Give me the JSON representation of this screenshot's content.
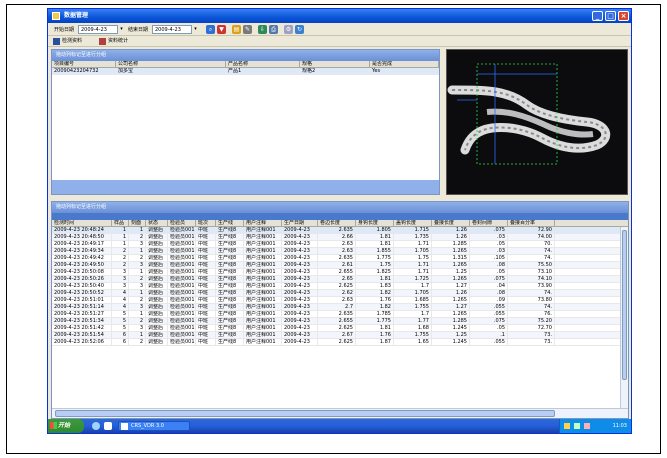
{
  "window": {
    "title": "数据管理"
  },
  "toolbar": {
    "start_label": "开始日期",
    "start_date": "2009-4-23",
    "end_label": "结束日期",
    "end_date": "2009-4-23"
  },
  "tabs": [
    {
      "label": "检测资料"
    },
    {
      "label": "资料统计"
    }
  ],
  "top_panel": {
    "header": "拖动列标记至进行分组",
    "columns": [
      "项目编号",
      "公司名称",
      "产品名称",
      "规格",
      "是否完成"
    ],
    "rows": [
      [
        "20090423204732",
        "加多宝",
        "产品1",
        "规格2",
        "Yes"
      ]
    ]
  },
  "bottom_panel": {
    "header": "拖动列标记至进行分组",
    "columns": [
      "检测时间",
      "样品",
      "刻面",
      "状态",
      "检验员",
      "班次",
      "生产线",
      "用户注释",
      "生产日期",
      "卷边长度",
      "身钩长度",
      "盖钩长度",
      "叠接长度",
      "卷封间隙",
      "叠接百分率"
    ],
    "rows": [
      [
        "2009-4-23 20:48:24",
        "1",
        "1",
        "调整后",
        "检验员001",
        "中班",
        "生产线8",
        "用户注释001",
        "2009-4-23",
        "2.635",
        "1.805",
        "1.715",
        "1.26",
        ".075",
        "72.90"
      ],
      [
        "2009-4-23 20:48:50",
        "1",
        "2",
        "调整后",
        "检验员001",
        "中班",
        "生产线8",
        "用户注释001",
        "2009-4-23",
        "2.66",
        "1.81",
        "1.735",
        "1.26",
        ".03",
        "74.00"
      ],
      [
        "2009-4-23 20:49:17",
        "1",
        "3",
        "调整后",
        "检验员001",
        "中班",
        "生产线8",
        "用户注释001",
        "2009-4-23",
        "2.63",
        "1.81",
        "1.71",
        "1.285",
        ".05",
        "70."
      ],
      [
        "2009-4-23 20:49:34",
        "2",
        "1",
        "调整后",
        "检验员001",
        "中班",
        "生产线8",
        "用户注释001",
        "2009-4-23",
        "2.63",
        "1.855",
        "1.705",
        "1.265",
        ".03",
        "74."
      ],
      [
        "2009-4-23 20:49:42",
        "2",
        "2",
        "调整后",
        "检验员001",
        "中班",
        "生产线8",
        "用户注释001",
        "2009-4-23",
        "2.635",
        "1.775",
        "1.75",
        "1.315",
        ".105",
        "74."
      ],
      [
        "2009-4-23 20:49:50",
        "2",
        "3",
        "调整后",
        "检验员001",
        "中班",
        "生产线8",
        "用户注释001",
        "2009-4-23",
        "2.61",
        "1.75",
        "1.71",
        "1.265",
        ".08",
        "75.50"
      ],
      [
        "2009-4-23 20:50:08",
        "3",
        "1",
        "调整后",
        "检验员001",
        "中班",
        "生产线8",
        "用户注释001",
        "2009-4-23",
        "2.655",
        "1.825",
        "1.71",
        "1.25",
        ".05",
        "73.10"
      ],
      [
        "2009-4-23 20:50:26",
        "3",
        "2",
        "调整后",
        "检验员001",
        "中班",
        "生产线8",
        "用户注释001",
        "2009-4-23",
        "2.65",
        "1.81",
        "1.725",
        "1.265",
        ".075",
        "74.10"
      ],
      [
        "2009-4-23 20:50:40",
        "3",
        "3",
        "调整后",
        "检验员001",
        "中班",
        "生产线8",
        "用户注释001",
        "2009-4-23",
        "2.625",
        "1.83",
        "1.7",
        "1.27",
        ".04",
        "73.90"
      ],
      [
        "2009-4-23 20:50:52",
        "4",
        "1",
        "调整后",
        "检验员001",
        "中班",
        "生产线8",
        "用户注释001",
        "2009-4-23",
        "2.62",
        "1.82",
        "1.705",
        "1.26",
        ".08",
        "74."
      ],
      [
        "2009-4-23 20:51:01",
        "4",
        "2",
        "调整后",
        "检验员001",
        "中班",
        "生产线8",
        "用户注释001",
        "2009-4-23",
        "2.63",
        "1.76",
        "1.685",
        "1.265",
        ".09",
        "73.80"
      ],
      [
        "2009-4-23 20:51:14",
        "4",
        "3",
        "调整后",
        "检验员001",
        "中班",
        "生产线8",
        "用户注释001",
        "2009-4-23",
        "2.7",
        "1.82",
        "1.755",
        "1.27",
        ".055",
        "74."
      ],
      [
        "2009-4-23 20:51:27",
        "5",
        "1",
        "调整后",
        "检验员001",
        "中班",
        "生产线8",
        "用户注释001",
        "2009-4-23",
        "2.635",
        "1.785",
        "1.7",
        "1.265",
        ".055",
        "76."
      ],
      [
        "2009-4-23 20:51:34",
        "5",
        "2",
        "调整后",
        "检验员001",
        "中班",
        "生产线8",
        "用户注释001",
        "2009-4-23",
        "2.655",
        "1.775",
        "1.77",
        "1.285",
        ".075",
        "75.20"
      ],
      [
        "2009-4-23 20:51:42",
        "5",
        "3",
        "调整后",
        "检验员001",
        "中班",
        "生产线8",
        "用户注释001",
        "2009-4-23",
        "2.625",
        "1.81",
        "1.68",
        "1.245",
        ".05",
        "72.70"
      ],
      [
        "2009-4-23 20:51:54",
        "6",
        "1",
        "调整后",
        "检验员001",
        "中班",
        "生产线8",
        "用户注释001",
        "2009-4-23",
        "2.67",
        "1.76",
        "1.755",
        "1.25",
        ".1",
        "73."
      ],
      [
        "2009-4-23 20:52:06",
        "6",
        "2",
        "调整后",
        "检验员001",
        "中班",
        "生产线8",
        "用户注释001",
        "2009-4-23",
        "2.625",
        "1.87",
        "1.65",
        "1.245",
        ".055",
        "73."
      ]
    ]
  },
  "taskbar": {
    "start_label": "开始",
    "task_label": "CRS_VDR 3.0",
    "clock": "11:03"
  }
}
